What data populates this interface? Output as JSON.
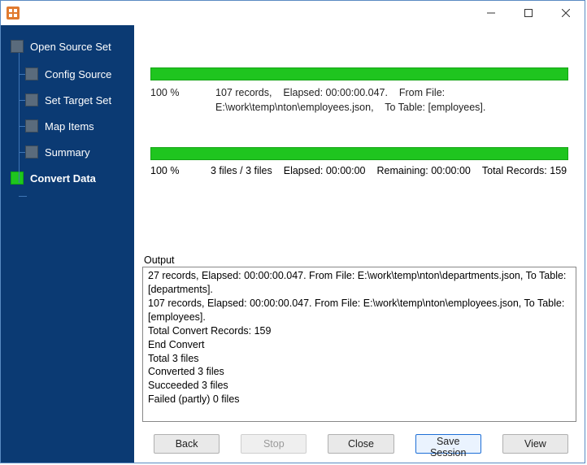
{
  "titlebar": {
    "title": ""
  },
  "sidebar": {
    "root": "Open Source Set",
    "children": [
      "Config Source",
      "Set Target Set",
      "Map Items",
      "Summary"
    ],
    "last": "Convert Data"
  },
  "progress1": {
    "percent": "100 %",
    "records": "107 records,",
    "elapsed": "Elapsed: 00:00:00.047.",
    "from_label": "From File:",
    "from_value": "E:\\work\\temp\\nton\\employees.json,",
    "to_label": "To Table: [employees]."
  },
  "progress2": {
    "percent": "100 %",
    "files": "3 files / 3 files",
    "elapsed": "Elapsed: 00:00:00",
    "remaining": "Remaining: 00:00:00",
    "total": "Total Records: 159"
  },
  "output": {
    "label": "Output",
    "lines": [
      "27 records,    Elapsed: 00:00:00.047.    From File: E:\\work\\temp\\nton\\departments.json,    To Table: [departments].",
      "107 records,    Elapsed: 00:00:00.047.    From File: E:\\work\\temp\\nton\\employees.json,    To Table: [employees].",
      "Total Convert Records: 159",
      "End Convert",
      "Total 3 files",
      "Converted 3 files",
      "Succeeded 3 files",
      "Failed (partly) 0 files"
    ]
  },
  "buttons": {
    "back": "Back",
    "stop": "Stop",
    "close": "Close",
    "save": "Save Session",
    "view": "View"
  }
}
